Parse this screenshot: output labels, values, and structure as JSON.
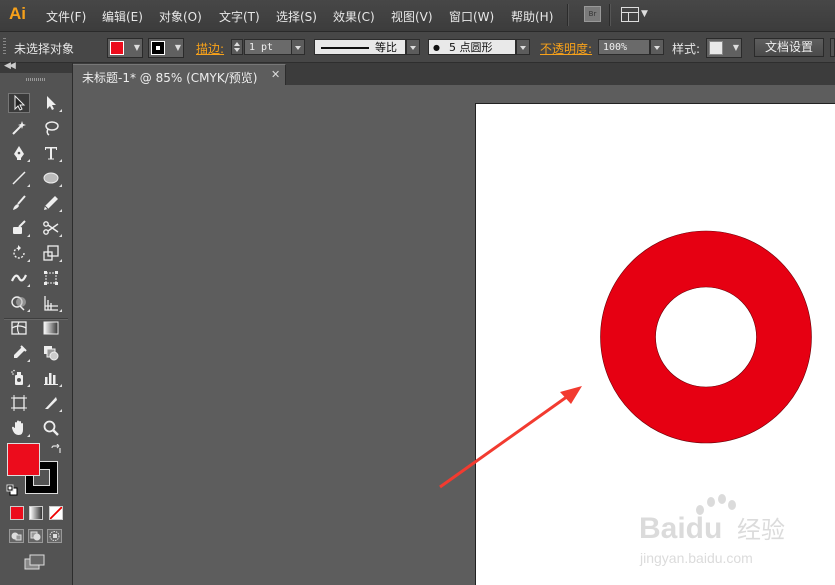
{
  "app": {
    "logo": "Ai"
  },
  "menu": [
    {
      "label": "文件(F)"
    },
    {
      "label": "编辑(E)"
    },
    {
      "label": "对象(O)"
    },
    {
      "label": "文字(T)"
    },
    {
      "label": "选择(S)"
    },
    {
      "label": "效果(C)"
    },
    {
      "label": "视图(V)"
    },
    {
      "label": "窗口(W)"
    },
    {
      "label": "帮助(H)"
    }
  ],
  "menu_buttons": {
    "bridge": "Br"
  },
  "control_bar": {
    "selection_status": "未选择对象",
    "fill_color": "#ec0c1c",
    "stroke_color": "#000000",
    "stroke_label": "描边:",
    "stroke_weight": "1 pt",
    "stroke_profile": "等比",
    "brush": "5 点圆形",
    "brush_dot": "●",
    "opacity_label": "不透明度:",
    "opacity_value": "100%",
    "style_label": "样式:",
    "doc_setup_button": "文档设置"
  },
  "document": {
    "tab_title": "未标题-1* @ 85% (CMYK/预览)",
    "close_glyph": "✕"
  },
  "toolbox": {
    "fill_color": "#ec0c1c",
    "stroke_color": "#000000"
  },
  "artwork": {
    "ring_color": "#e60012",
    "arrow_color": "#f23b30"
  },
  "watermark": {
    "brand": "Baidu",
    "brand_cn": "经验",
    "url": "jingyan.baidu.com"
  }
}
